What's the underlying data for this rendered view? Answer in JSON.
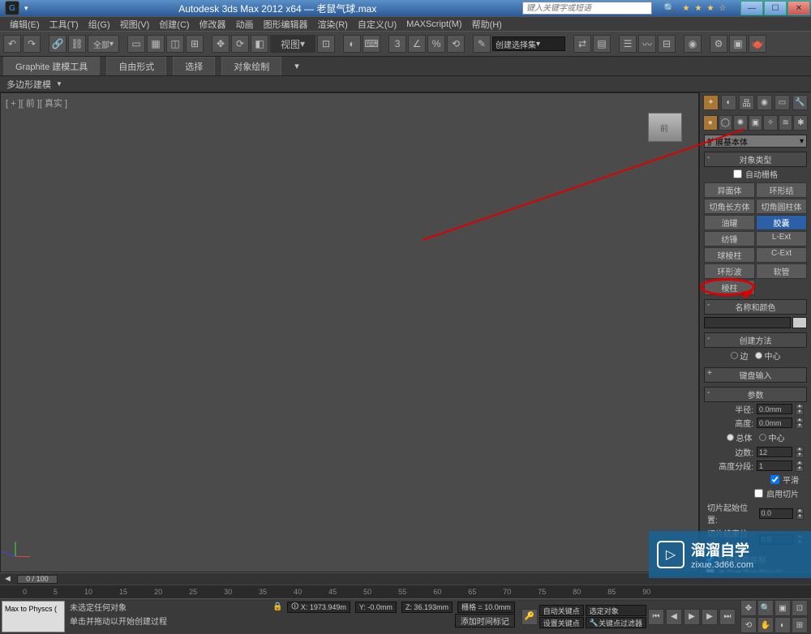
{
  "title": "Autodesk 3ds Max  2012 x64 — 老鼠气球.max",
  "search_placeholder": "键入关键字或短语",
  "menus": [
    "编辑(E)",
    "工具(T)",
    "组(G)",
    "视图(V)",
    "创建(C)",
    "修改器",
    "动画",
    "图形编辑器",
    "渲染(R)",
    "自定义(U)",
    "MAXScript(M)",
    "帮助(H)"
  ],
  "toolbar": {
    "scope": "全部",
    "view_label": "视图",
    "selectset": "创建选择集"
  },
  "ribbon": {
    "tabs": [
      "Graphite 建模工具",
      "自由形式",
      "选择",
      "对象绘制"
    ],
    "sub": "多边形建模"
  },
  "viewport_label": "[ + ][ 前 ][ 真实 ]",
  "cmd": {
    "dropdown": "扩展基本体",
    "objtype_title": "对象类型",
    "autogrid": "自动栅格",
    "buttons": [
      [
        "异面体",
        "环形结"
      ],
      [
        "切角长方体",
        "切角圆柱体"
      ],
      [
        "油罐",
        "胶囊"
      ],
      [
        "纺锤",
        "L-Ext"
      ],
      [
        "球棱柱",
        "C-Ext"
      ],
      [
        "环形波",
        "软管"
      ],
      [
        "棱柱",
        ""
      ]
    ],
    "selected": "胶囊",
    "namecolor_title": "名称和颜色",
    "createmethod_title": "创建方法",
    "cm_edge": "边",
    "cm_center": "中心",
    "kbentry_title": "键盘输入",
    "params_title": "参数",
    "radius_label": "半径:",
    "radius_val": "0.0mm",
    "height_label": "高度:",
    "height_val": "0.0mm",
    "overall": "总体",
    "centers": "中心",
    "sides_label": "边数:",
    "sides_val": "12",
    "hseg_label": "高度分段:",
    "hseg_val": "1",
    "smooth": "平滑",
    "sliceon": "启用切片",
    "slicefrom_label": "切片起始位置:",
    "slicefrom_val": "0.0",
    "sliceto_label": "切片结束位置:",
    "sliceto_val": "0.0",
    "genmap": "生成贴图坐标",
    "realworld": "真实世界地图比例"
  },
  "timeline": {
    "pos": "0 / 100",
    "ticks": [
      "0",
      "5",
      "10",
      "15",
      "20",
      "25",
      "30",
      "35",
      "40",
      "45",
      "50",
      "55",
      "60",
      "65",
      "70",
      "75",
      "80",
      "85",
      "90"
    ]
  },
  "status": {
    "script": "Max to Physcs (",
    "nosel": "未选定任何对象",
    "prompt": "单击并拖动以开始创建过程",
    "addtime": "添加时间标记",
    "x": "X: 1973.949m",
    "y": "Y: -0.0mm",
    "z": "Z: 36.193mm",
    "grid": "栅格 = 10.0mm",
    "autokey": "自动关键点",
    "selobj": "选定对象",
    "setkey": "设置关键点",
    "keyfilter": "关键点过滤器"
  },
  "watermark": {
    "brand": "溜溜自学",
    "url": "zixue.3d66.com"
  }
}
